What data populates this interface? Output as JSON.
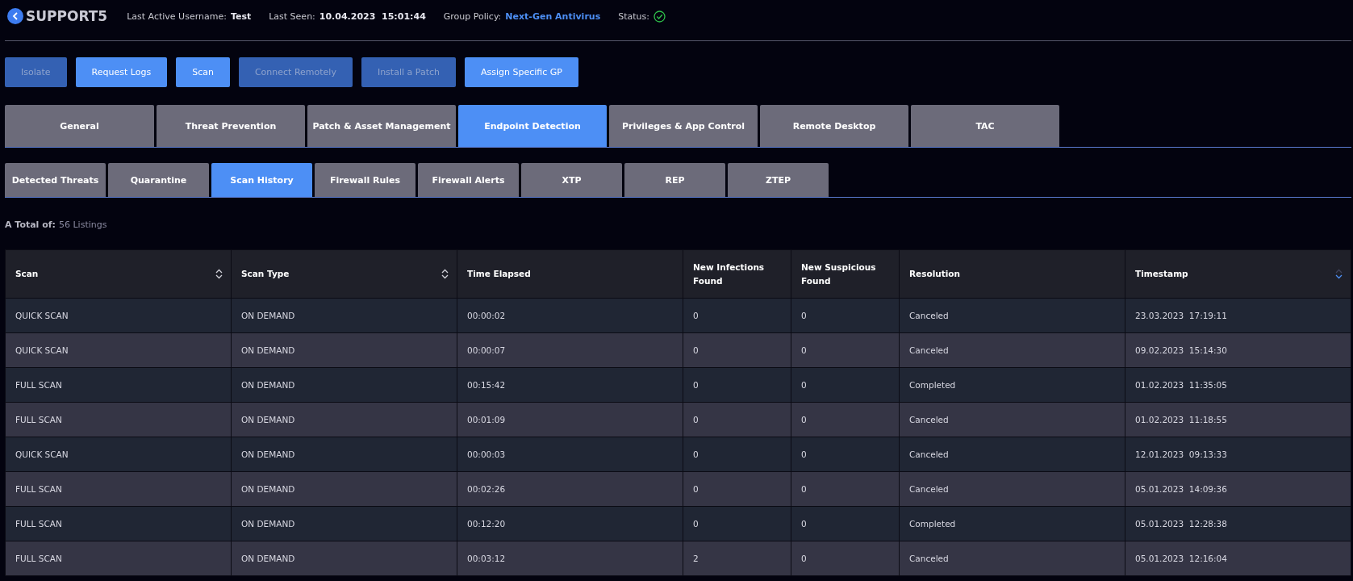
{
  "header": {
    "title": "SUPPORT5",
    "fields": [
      {
        "label": "Last Active Username:",
        "value": "Test",
        "kind": "text"
      },
      {
        "label": "Last Seen:",
        "value": "10.04.2023  15:01:44",
        "kind": "text"
      },
      {
        "label": "Group Policy:",
        "value": "Next-Gen Antivirus",
        "kind": "link"
      }
    ],
    "status": {
      "label": "Status:",
      "ok": true
    }
  },
  "actions": [
    {
      "label": "Isolate",
      "disabled": true
    },
    {
      "label": "Request Logs",
      "disabled": false
    },
    {
      "label": "Scan",
      "disabled": false
    },
    {
      "label": "Connect Remotely",
      "disabled": true
    },
    {
      "label": "Install a Patch",
      "disabled": true
    },
    {
      "label": "Assign Specific GP",
      "disabled": false
    }
  ],
  "tabs": [
    {
      "label": "General",
      "selected": false
    },
    {
      "label": "Threat Prevention",
      "selected": false
    },
    {
      "label": "Patch & Asset Management",
      "selected": false
    },
    {
      "label": "Endpoint Detection",
      "selected": true
    },
    {
      "label": "Privileges & App Control",
      "selected": false
    },
    {
      "label": "Remote Desktop",
      "selected": false
    },
    {
      "label": "TAC",
      "selected": false
    }
  ],
  "subtabs": [
    {
      "label": "Detected Threats",
      "selected": false
    },
    {
      "label": "Quarantine",
      "selected": false
    },
    {
      "label": "Scan History",
      "selected": true
    },
    {
      "label": "Firewall Rules",
      "selected": false
    },
    {
      "label": "Firewall Alerts",
      "selected": false
    },
    {
      "label": "XTP",
      "selected": false
    },
    {
      "label": "REP",
      "selected": false
    },
    {
      "label": "ZTEP",
      "selected": false
    }
  ],
  "total": {
    "label": "A Total of:",
    "value": "56 Listings"
  },
  "table": {
    "columns": [
      {
        "label": "Scan",
        "sortable": true,
        "sorted_desc": false
      },
      {
        "label": "Scan Type",
        "sortable": true,
        "sorted_desc": false
      },
      {
        "label": "Time Elapsed",
        "sortable": false
      },
      {
        "label": "New Infections Found",
        "sortable": false
      },
      {
        "label": "New Suspicious Found",
        "sortable": false
      },
      {
        "label": "Resolution",
        "sortable": false
      },
      {
        "label": "Timestamp",
        "sortable": true,
        "sorted_desc": true
      }
    ],
    "rows": [
      [
        "QUICK SCAN",
        "ON DEMAND",
        "00:00:02",
        "0",
        "0",
        "Canceled",
        "23.03.2023  17:19:11"
      ],
      [
        "QUICK SCAN",
        "ON DEMAND",
        "00:00:07",
        "0",
        "0",
        "Canceled",
        "09.02.2023  15:14:30"
      ],
      [
        "FULL SCAN",
        "ON DEMAND",
        "00:15:42",
        "0",
        "0",
        "Completed",
        "01.02.2023  11:35:05"
      ],
      [
        "FULL SCAN",
        "ON DEMAND",
        "00:01:09",
        "0",
        "0",
        "Canceled",
        "01.02.2023  11:18:55"
      ],
      [
        "QUICK SCAN",
        "ON DEMAND",
        "00:00:03",
        "0",
        "0",
        "Canceled",
        "12.01.2023  09:13:33"
      ],
      [
        "FULL SCAN",
        "ON DEMAND",
        "00:02:26",
        "0",
        "0",
        "Canceled",
        "05.01.2023  14:09:36"
      ],
      [
        "FULL SCAN",
        "ON DEMAND",
        "00:12:20",
        "0",
        "0",
        "Completed",
        "05.01.2023  12:28:38"
      ],
      [
        "FULL SCAN",
        "ON DEMAND",
        "00:03:12",
        "2",
        "0",
        "Canceled",
        "05.01.2023  12:16:04"
      ]
    ]
  }
}
